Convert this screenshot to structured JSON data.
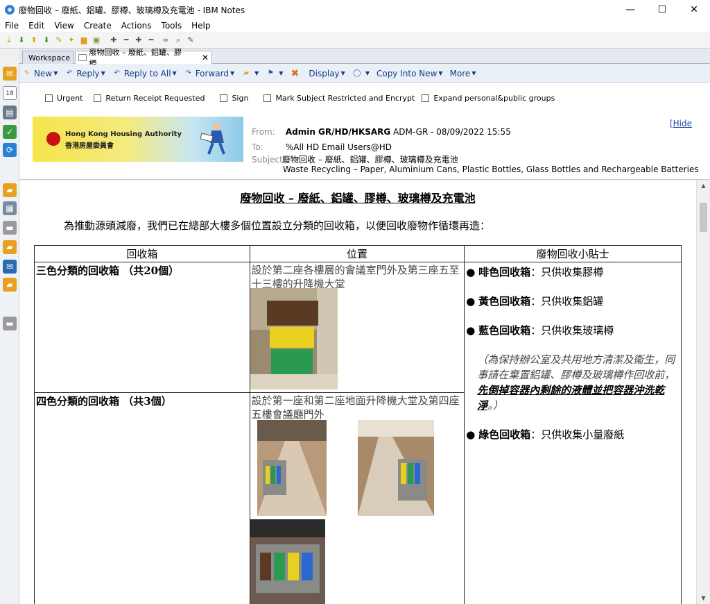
{
  "window": {
    "title": "廢物回收 – 廢紙、鋁罐、膠樽、玻璃樽及充電池 - IBM Notes",
    "controls": {
      "minimize": "—",
      "maximize": "☐",
      "close": "✕"
    }
  },
  "menu": [
    "File",
    "Edit",
    "View",
    "Create",
    "Actions",
    "Tools",
    "Help"
  ],
  "tabs": [
    {
      "label": "Workspace"
    },
    {
      "label": "廢物回收 – 廢紙、鋁罐、膠樽、...",
      "close": "✕"
    }
  ],
  "actions": [
    "New",
    "Reply",
    "Reply to All",
    "Forward",
    "Display",
    "Copy Into New",
    "More"
  ],
  "options": [
    "Urgent",
    "Return Receipt Requested",
    "Sign",
    "Mark Subject Restricted and Encrypt",
    "Expand personal&public groups"
  ],
  "logo": {
    "en": "Hong Kong Housing Authority",
    "zh": "香港房屋委員會"
  },
  "hide_link": "[Hide",
  "header": {
    "from_label": "From:",
    "from_name": "Admin GR/HD/HKSARG",
    "from_rest": "ADM-GR - 08/09/2022 15:55",
    "to_label": "To:",
    "to_value": "%All HD Email Users@HD",
    "subject_label": "Subject:",
    "subject_zh": "廢物回收 – 廢紙、鋁罐、膠樽、玻璃樽及充電池",
    "subject_en": "Waste Recycling – Paper, Aluminium Cans, Plastic Bottles, Glass Bottles and Rechargeable Batteries"
  },
  "body": {
    "title": "廢物回收 – 廢紙、鋁罐、膠樽、玻璃樽及充電池",
    "intro": "為推動源頭減廢，我們已在總部大樓多個位置設立分類的回收箱，以便回收廢物作循環再造：",
    "table": {
      "headers": [
        "回收箱",
        "位置",
        "廢物回收小貼士"
      ],
      "rows": [
        {
          "box": "三色分類的回收箱 （共20個）",
          "location": "設於第二座各樓層的會議室門外及第三座五至十三樓的升降機大堂"
        },
        {
          "box": "四色分類的回收箱 （共3個）",
          "location": "設於第一座和第二座地面升降機大堂及第四座五樓會議廳門外"
        }
      ],
      "tips": [
        {
          "color": "啡色回收箱",
          "text": "：只供收集膠樽"
        },
        {
          "color": "黃色回收箱",
          "text": "：只供收集鋁罐"
        },
        {
          "color": "藍色回收箱",
          "text": "：只供收集玻璃樽"
        }
      ],
      "note_plain": "（為保持辦公室及共用地方清潔及衞生，同事請在棄置鋁罐、膠樽及玻璃樽作回收前，",
      "note_emph": "先倒掉容器內剩餘的液體並把容器沖洗乾淨",
      "note_end": "。）",
      "tip4": {
        "color": "綠色回收箱",
        "text": "：只供收集小量廢紙"
      },
      "bullet": "●"
    }
  }
}
